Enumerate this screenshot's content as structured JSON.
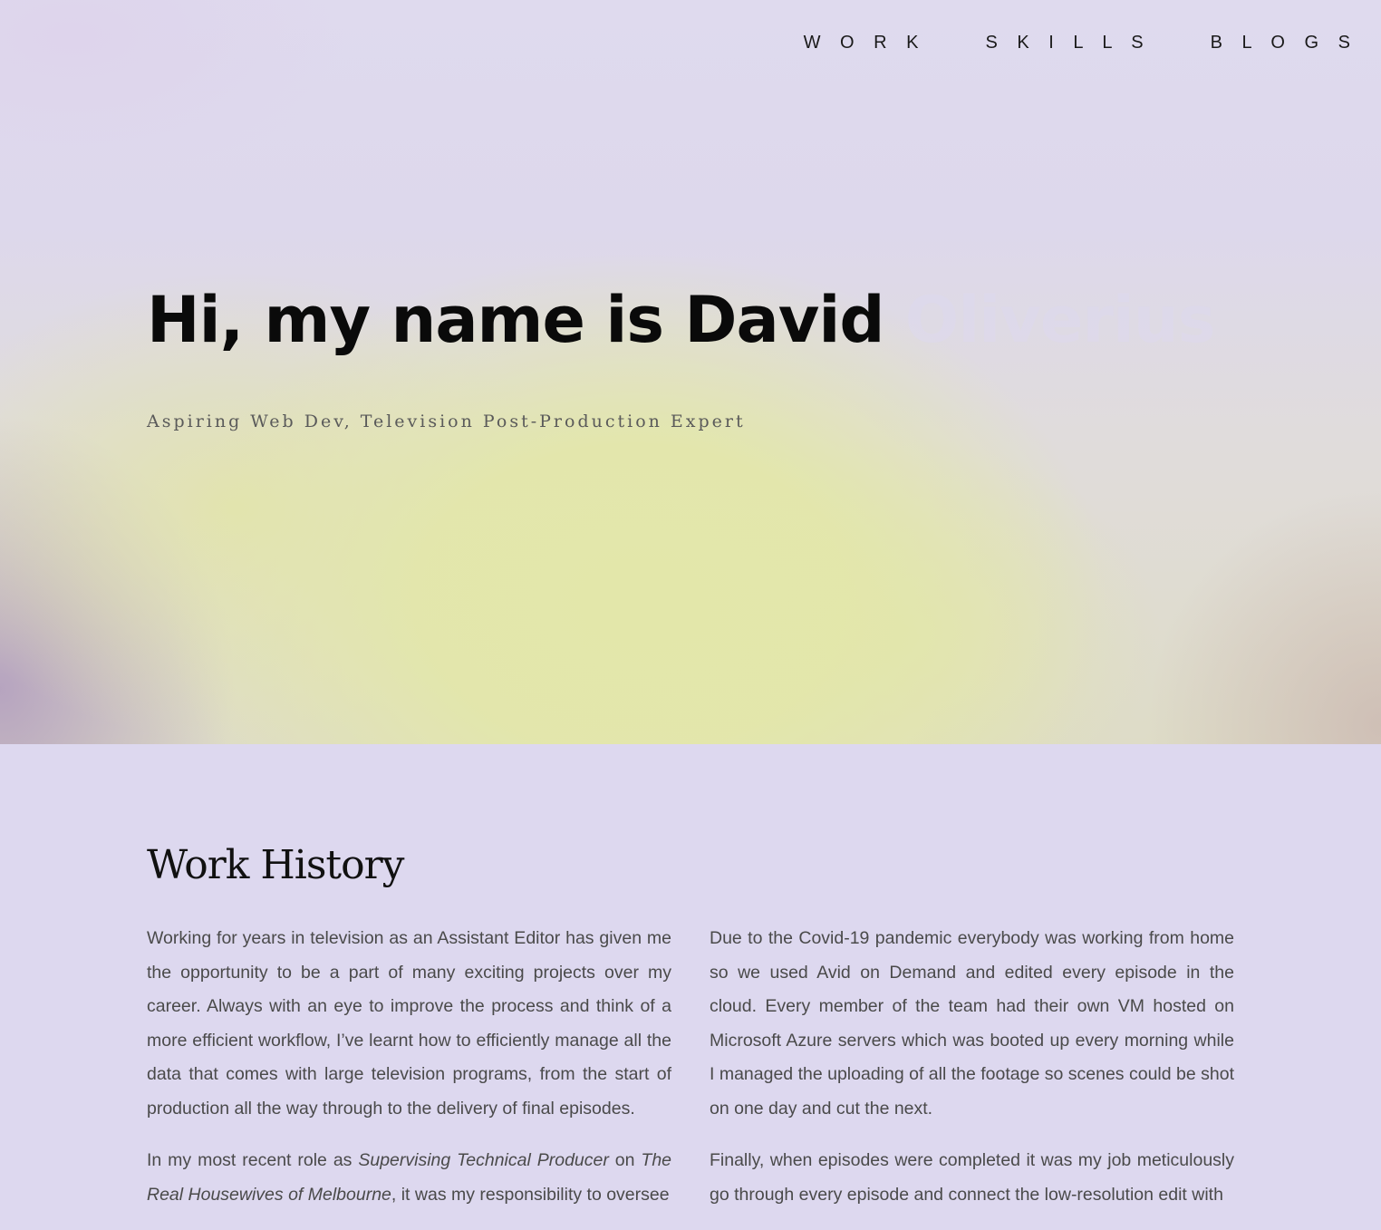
{
  "nav": {
    "items": [
      {
        "label": "W O R K"
      },
      {
        "label": "S K I L L S"
      },
      {
        "label": "B L O G S"
      }
    ]
  },
  "hero": {
    "title_visible": "Hi, my name is David",
    "title_faded": " Oliverius",
    "subtitle": "Aspiring Web Dev, Television Post-Production Expert"
  },
  "work": {
    "title": "Work History",
    "left": {
      "p1": "Working for years in television as an Assistant Editor has given me the opportunity to be a part of many exciting projects over my career. Always with an eye to improve the process and think of a more efficient workflow, I’ve learnt how to efficiently manage all the data that comes with large television programs, from the start of production all the way through to the delivery of final episodes.",
      "p2_a": "In my most recent role as ",
      "p2_role": "Supervising Technical Producer",
      "p2_b": " on ",
      "p2_show": "The Real Housewives of Melbourne",
      "p2_c": ", it was my responsibility to oversee"
    },
    "right": {
      "p1": "Due to the Covid-19 pandemic everybody was working from home so we used Avid on Demand and edited every episode in the cloud. Every member of the team had their own VM hosted on Microsoft Azure servers which was booted up every morning while I managed the uploading of all the footage so scenes could be shot on one day and cut the next.",
      "p2": "Finally, when episodes were completed it was my job meticulously go through every episode and connect the low-resolution edit with"
    }
  }
}
